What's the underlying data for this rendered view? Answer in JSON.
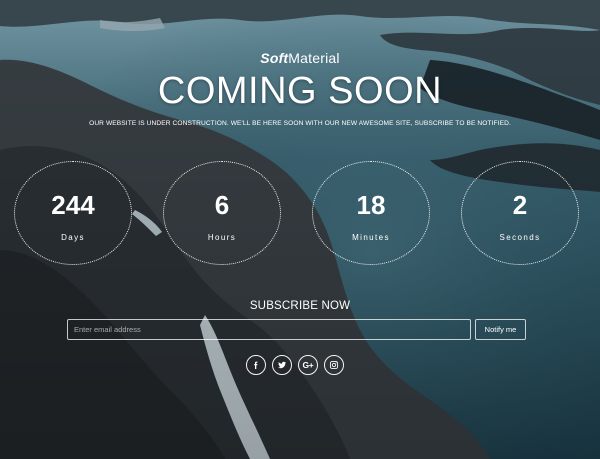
{
  "logo": {
    "bold": "Soft",
    "light": "Material"
  },
  "hero": {
    "title": "COMING SOON",
    "subtitle": "OUR WEBSITE IS UNDER CONSTRUCTION. WE'LL BE HERE SOON WITH OUR NEW AWESOME SITE, SUBSCRIBE TO BE NOTIFIED."
  },
  "countdown": [
    {
      "value": "244",
      "label": "Days"
    },
    {
      "value": "6",
      "label": "Hours"
    },
    {
      "value": "18",
      "label": "Minutes"
    },
    {
      "value": "2",
      "label": "Seconds"
    }
  ],
  "subscribe": {
    "heading": "SUBSCRIBE NOW",
    "placeholder": "Enter email address",
    "button": "Notify me"
  },
  "social": [
    {
      "icon": "facebook-icon",
      "glyph": "f"
    },
    {
      "icon": "twitter-icon",
      "glyph": ""
    },
    {
      "icon": "google-plus-icon",
      "glyph": "G+"
    },
    {
      "icon": "instagram-icon",
      "glyph": ""
    }
  ]
}
